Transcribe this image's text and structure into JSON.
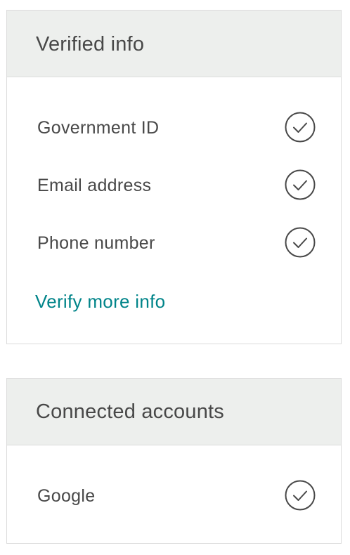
{
  "verified_info": {
    "title": "Verified info",
    "items": [
      {
        "label": "Government ID",
        "verified": true,
        "icon": "check-circle-icon"
      },
      {
        "label": "Email address",
        "verified": true,
        "icon": "check-circle-icon"
      },
      {
        "label": "Phone number",
        "verified": true,
        "icon": "check-circle-icon"
      }
    ],
    "verify_more_link": "Verify more info"
  },
  "connected_accounts": {
    "title": "Connected accounts",
    "items": [
      {
        "label": "Google",
        "connected": true,
        "icon": "check-circle-icon"
      }
    ]
  },
  "colors": {
    "link": "#008489",
    "text": "#484848",
    "header_bg": "#edefed",
    "border": "#dcdcdc"
  }
}
